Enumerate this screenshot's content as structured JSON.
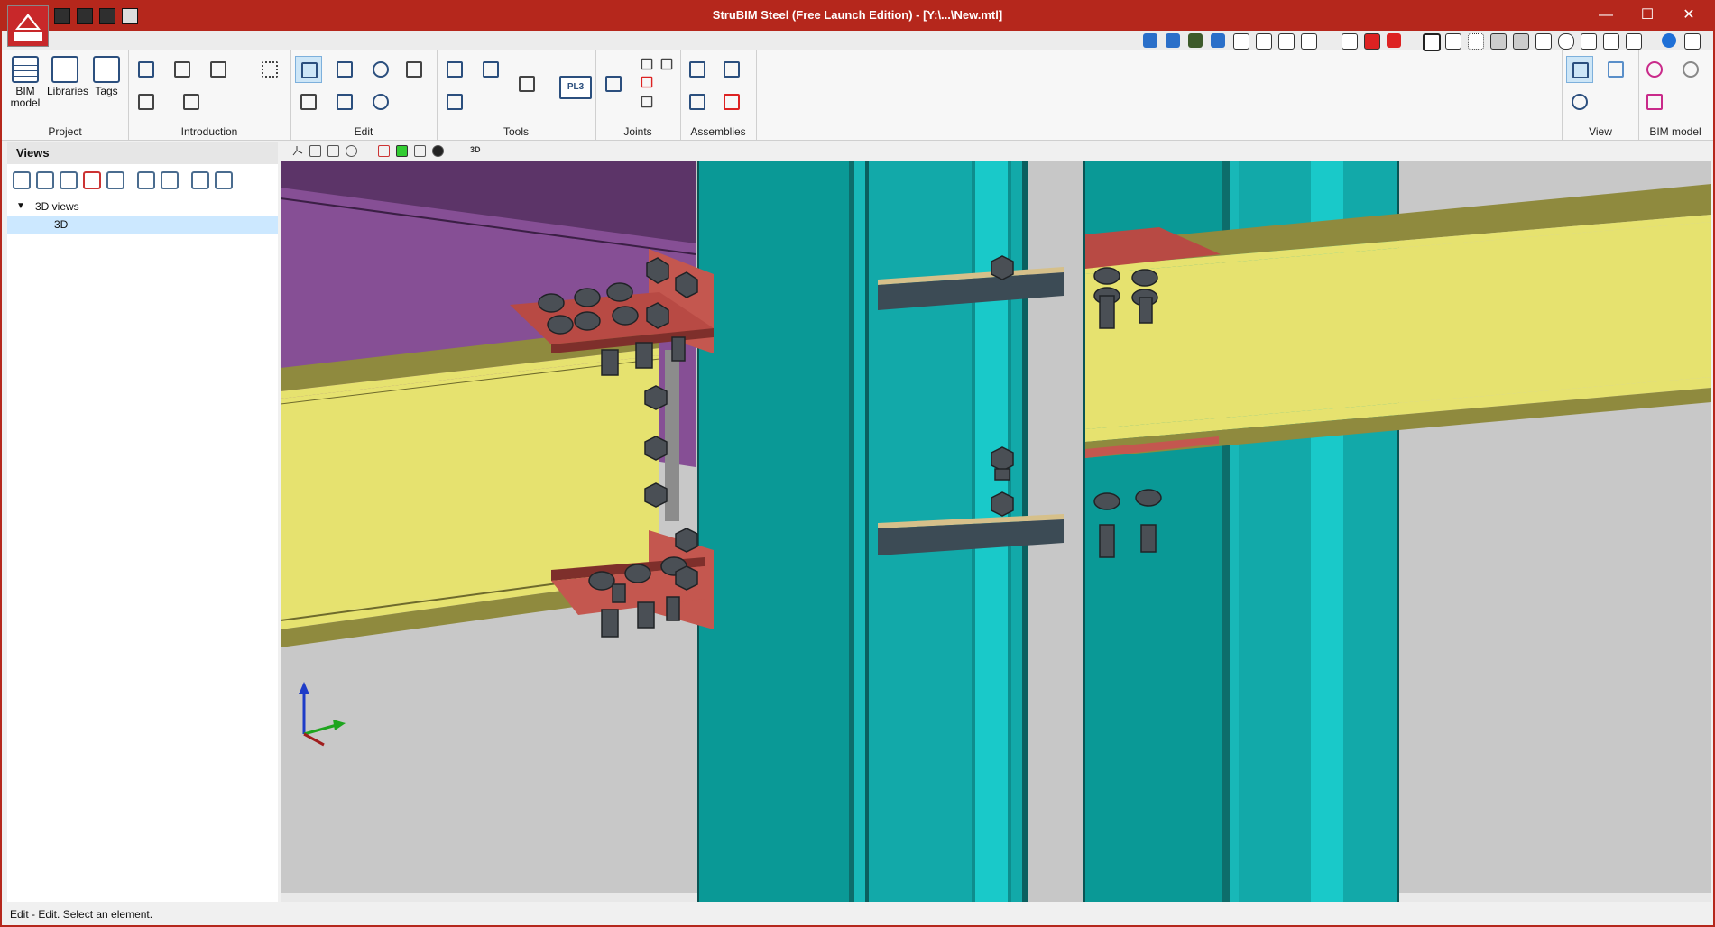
{
  "window": {
    "title": "StruBIM Steel (Free Launch Edition) - [Y:\\...\\New.mtl]",
    "minimize": "—",
    "maximize": "☐",
    "close": "✕"
  },
  "ribbon": {
    "groups": {
      "project": "Project",
      "introduction": "Introduction",
      "edit": "Edit",
      "tools": "Tools",
      "joints": "Joints",
      "assemblies": "Assemblies",
      "view": "View",
      "bim_model": "BIM model"
    },
    "buttons": {
      "bim_model": "BIM model",
      "libraries": "Libraries",
      "tags": "Tags",
      "pl3": "PL3"
    }
  },
  "views_panel": {
    "title": "Views",
    "tree": {
      "root": "3D views",
      "items": [
        "3D"
      ]
    }
  },
  "viewport_toolbar": {
    "label_3d": "3D"
  },
  "status": "Edit - Edit. Select an element.",
  "colors": {
    "titlebar": "#b5271c",
    "beam_web": "#e6e26f",
    "beam_flange": "#8f8a3e",
    "column": "#14a0a0",
    "plate": "#c4574f",
    "bolt": "#4a4f55",
    "slab": "#7b3f88"
  }
}
